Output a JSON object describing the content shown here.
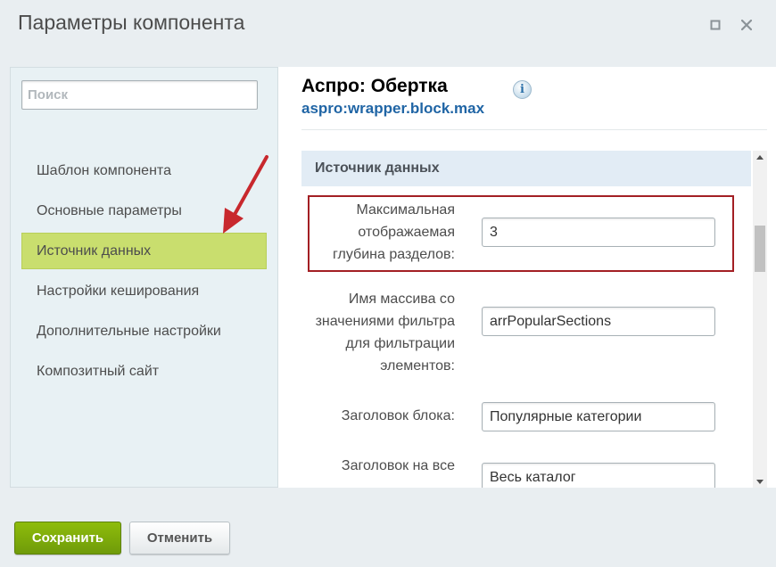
{
  "window": {
    "title": "Параметры компонента",
    "maximize_icon": "maximize-icon",
    "close_icon": "close-icon"
  },
  "sidebar": {
    "search_placeholder": "Поиск",
    "items": [
      {
        "label": "Шаблон компонента",
        "active": false
      },
      {
        "label": "Основные параметры",
        "active": false
      },
      {
        "label": "Источник данных",
        "active": true
      },
      {
        "label": "Настройки кеширования",
        "active": false
      },
      {
        "label": "Дополнительные настройки",
        "active": false
      },
      {
        "label": "Композитный сайт",
        "active": false
      }
    ]
  },
  "component": {
    "name": "Аспро: Обертка",
    "id": "aspro:wrapper.block.max",
    "info_icon": "info-icon"
  },
  "section": {
    "title": "Источник данных",
    "fields": [
      {
        "label_lines": [
          "Максимальная",
          "отображаемая",
          "глубина разделов:"
        ],
        "value": "3",
        "highlighted": true
      },
      {
        "label_lines": [
          "Имя массива со",
          "значениями фильтра",
          "для фильтрации",
          "элементов:"
        ],
        "value": "arrPopularSections",
        "highlighted": false
      },
      {
        "label_lines": [
          "Заголовок блока:"
        ],
        "value": "Популярные категории",
        "highlighted": false
      },
      {
        "label_lines": [
          "Заголовок на все"
        ],
        "value": "Весь каталог",
        "highlighted": false
      }
    ]
  },
  "footer": {
    "save_label": "Сохранить",
    "cancel_label": "Отменить"
  },
  "colors": {
    "active_item": "#c9de6e",
    "highlight_border": "#a31f24",
    "annotation_arrow": "#c8282d",
    "save_button": "#7eab0b",
    "component_id": "#2065a5"
  }
}
